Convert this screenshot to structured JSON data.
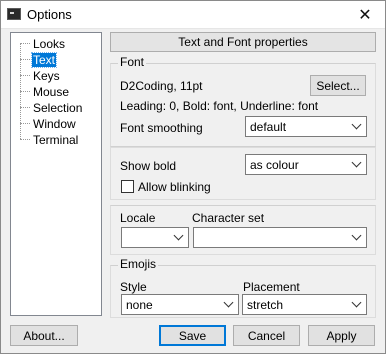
{
  "window": {
    "title": "Options",
    "close_glyph": "✕"
  },
  "tree": {
    "items": [
      {
        "label": "Looks"
      },
      {
        "label": "Text"
      },
      {
        "label": "Keys"
      },
      {
        "label": "Mouse"
      },
      {
        "label": "Selection"
      },
      {
        "label": "Window"
      },
      {
        "label": "Terminal"
      }
    ],
    "selected": "Text"
  },
  "panel": {
    "header": "Text and Font properties",
    "font_group": {
      "label": "Font",
      "font_name": "D2Coding, 11pt",
      "select_button": "Select...",
      "details": "Leading: 0, Bold: font, Underline: font",
      "smoothing_label": "Font smoothing",
      "smoothing_value": "default"
    },
    "bold_group": {
      "show_bold_label": "Show bold",
      "show_bold_value": "as colour",
      "allow_blinking_label": "Allow blinking",
      "allow_blinking_checked": false
    },
    "locale_group": {
      "locale_label": "Locale",
      "locale_value": "",
      "charset_label": "Character set",
      "charset_value": ""
    },
    "emojis_group": {
      "label": "Emojis",
      "style_label": "Style",
      "style_value": "none",
      "placement_label": "Placement",
      "placement_value": "stretch"
    }
  },
  "buttons": {
    "about": "About...",
    "save": "Save",
    "cancel": "Cancel",
    "apply": "Apply"
  },
  "colors": {
    "selection": "#0078d7"
  }
}
